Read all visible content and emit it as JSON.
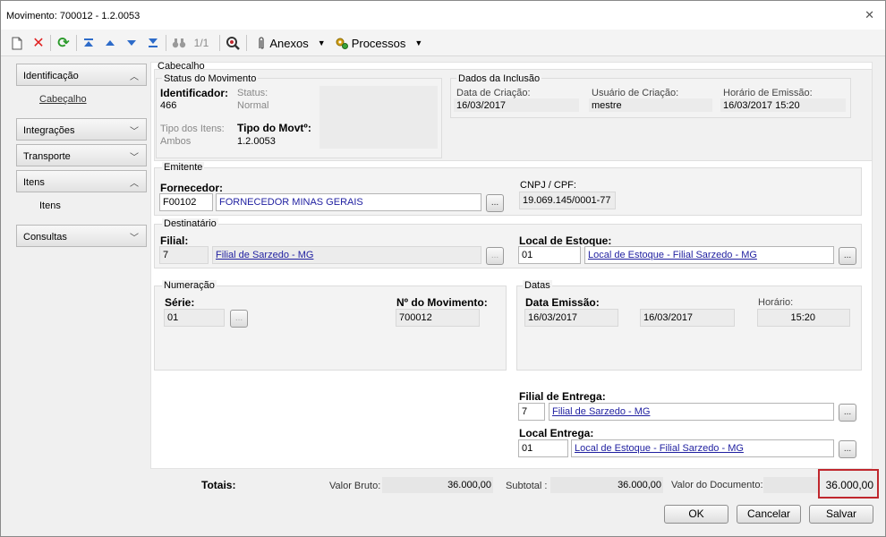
{
  "window": {
    "title": "Movimento: 700012 - 1.2.0053"
  },
  "toolbar": {
    "page_indicator": "1/1",
    "anexos_label": "Anexos",
    "processos_label": "Processos"
  },
  "sidebar": {
    "sections": [
      {
        "label": "Identificação",
        "expanded": true,
        "children": [
          "Cabeçalho"
        ]
      },
      {
        "label": "Integrações",
        "expanded": false
      },
      {
        "label": "Transporte",
        "expanded": false
      },
      {
        "label": "Itens",
        "expanded": true,
        "children": [
          "Itens"
        ]
      },
      {
        "label": "Consultas",
        "expanded": false
      }
    ]
  },
  "cabecalho": {
    "title": "Cabeçalho",
    "status": {
      "title": "Status do Movimento",
      "identificador_label": "Identificador:",
      "identificador_value": "466",
      "status_label": "Status:",
      "status_value": "Normal",
      "tipo_itens_label": "Tipo dos Itens:",
      "tipo_itens_value": "Ambos",
      "tipo_movto_label": "Tipo do Movtº:",
      "tipo_movto_value": "1.2.0053"
    },
    "inclusao": {
      "title": "Dados da Inclusão",
      "data_criacao_label": "Data de Criação:",
      "data_criacao_value": "16/03/2017",
      "usuario_label": "Usuário de Criação:",
      "usuario_value": "mestre",
      "horario_label": "Horário de Emissão:",
      "horario_value": "16/03/2017 15:20"
    }
  },
  "emitente": {
    "title": "Emitente",
    "fornecedor_label": "Fornecedor:",
    "fornecedor_code": "F00102",
    "fornecedor_name": "FORNECEDOR MINAS GERAIS",
    "cnpj_label": "CNPJ / CPF:",
    "cnpj_value": "19.069.145/0001-77"
  },
  "destinatario": {
    "title": "Destinatário",
    "filial_label": "Filial:",
    "filial_code": "7",
    "filial_name": "Filial de Sarzedo - MG",
    "local_label": "Local de Estoque:",
    "local_code": "01",
    "local_name": "Local de Estoque - Filial Sarzedo - MG"
  },
  "numeracao": {
    "title": "Numeração",
    "serie_label": "Série:",
    "serie_value": "01",
    "numero_label": "Nº do Movimento:",
    "numero_value": "700012"
  },
  "datas": {
    "title": "Datas",
    "emissao_label": "Data Emissão:",
    "emissao_value1": "16/03/2017",
    "emissao_value2": "16/03/2017",
    "horario_label": "Horário:",
    "horario_value": "15:20"
  },
  "entrega": {
    "filial_label": "Filial de Entrega:",
    "filial_code": "7",
    "filial_name": "Filial de Sarzedo - MG",
    "local_label": "Local Entrega:",
    "local_code": "01",
    "local_name": "Local de Estoque - Filial Sarzedo - MG"
  },
  "totais": {
    "label": "Totais:",
    "valor_bruto_label": "Valor Bruto:",
    "valor_bruto": "36.000,00",
    "subtotal_label": "Subtotal :",
    "subtotal": "36.000,00",
    "valor_doc_label": "Valor do Documento:",
    "valor_doc": "36.000,00"
  },
  "buttons": {
    "ok": "OK",
    "cancelar": "Cancelar",
    "salvar": "Salvar"
  },
  "colors": {
    "highlight_border": "#c0272d",
    "link": "#1f1fa0",
    "delete_icon": "#e02020",
    "refresh_icon": "#2a9a2a",
    "nav_icon": "#2d6bc9"
  }
}
